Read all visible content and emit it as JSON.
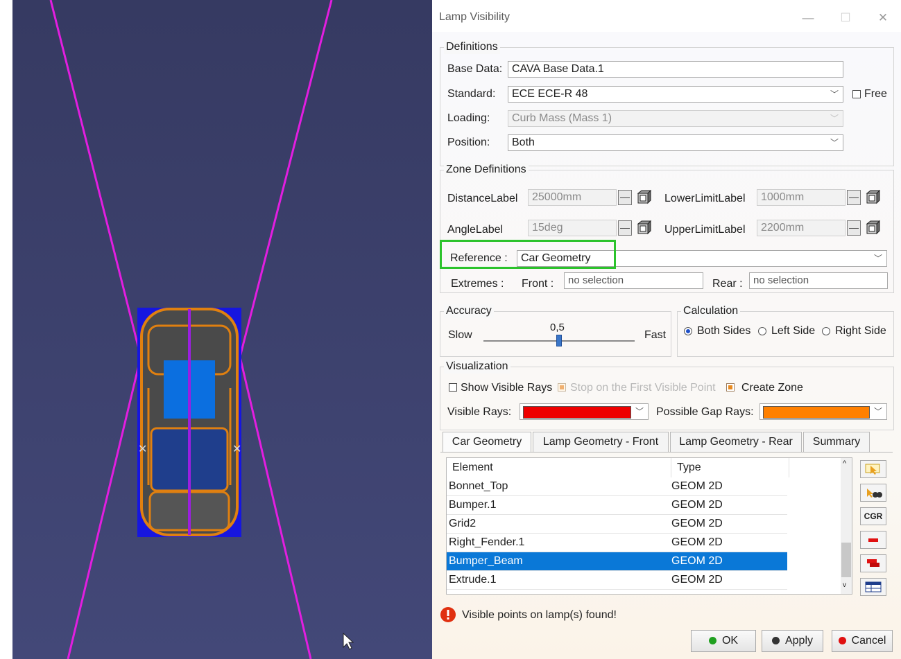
{
  "dialog": {
    "title": "Lamp Visibility",
    "window_controls": {
      "minimize": "—",
      "maximize": "☐",
      "close": "✕"
    }
  },
  "definitions": {
    "legend": "Definitions",
    "base_data_label": "Base Data:",
    "base_data_value": "CAVA Base Data.1",
    "standard_label": "Standard:",
    "standard_value": "ECE ECE-R 48",
    "free_label": "Free",
    "loading_label": "Loading:",
    "loading_value": "Curb Mass (Mass 1)",
    "position_label": "Position:",
    "position_value": "Both"
  },
  "zone": {
    "legend": "Zone Definitions",
    "distance_label": "DistanceLabel",
    "distance_value": "25000mm",
    "lower_label": "LowerLimitLabel",
    "lower_value": "1000mm",
    "angle_label": "AngleLabel",
    "angle_value": "15deg",
    "upper_label": "UpperLimitLabel",
    "upper_value": "2200mm",
    "reference_label": "Reference :",
    "reference_value": "Car Geometry",
    "extremes_label": "Extremes :",
    "front_label": "Front :",
    "front_value": "no selection",
    "rear_label": "Rear :",
    "rear_value": "no selection"
  },
  "accuracy": {
    "legend": "Accuracy",
    "slow": "Slow",
    "fast": "Fast",
    "value_text": "0,5",
    "value": 0.5
  },
  "calculation": {
    "legend": "Calculation",
    "options": [
      "Both Sides",
      "Left Side",
      "Right Side"
    ],
    "selected": "Both Sides"
  },
  "visualization": {
    "legend": "Visualization",
    "show_visible_rays": "Show Visible Rays",
    "stop_first": "Stop on the First Visible Point",
    "create_zone": "Create Zone",
    "visible_rays_label": "Visible Rays:",
    "visible_rays_color": "#ee0000",
    "gap_rays_label": "Possible Gap Rays:",
    "gap_rays_color": "#ff8000"
  },
  "tabs": [
    "Car Geometry",
    "Lamp Geometry - Front",
    "Lamp Geometry - Rear",
    "Summary"
  ],
  "table": {
    "headers": [
      "Element",
      "Type"
    ],
    "rows": [
      {
        "element": "Bonnet_Top",
        "type": "GEOM 2D"
      },
      {
        "element": "Bumper.1",
        "type": "GEOM 2D"
      },
      {
        "element": "Grid2",
        "type": "GEOM 2D"
      },
      {
        "element": "Right_Fender.1",
        "type": "GEOM 2D"
      },
      {
        "element": "Bumper_Beam",
        "type": "GEOM 2D"
      },
      {
        "element": "Extrude.1",
        "type": "GEOM 2D"
      }
    ],
    "selected_row": "Bumper_Beam",
    "side_cgr": "CGR"
  },
  "status": "Visible points on lamp(s) found!",
  "buttons": {
    "ok": "OK",
    "apply": "Apply",
    "cancel": "Cancel"
  },
  "colors": {
    "highlight": "#2cc32c",
    "selection": "#0a78d7",
    "viewport": "#3c4070",
    "rays": "#e21ee0"
  }
}
